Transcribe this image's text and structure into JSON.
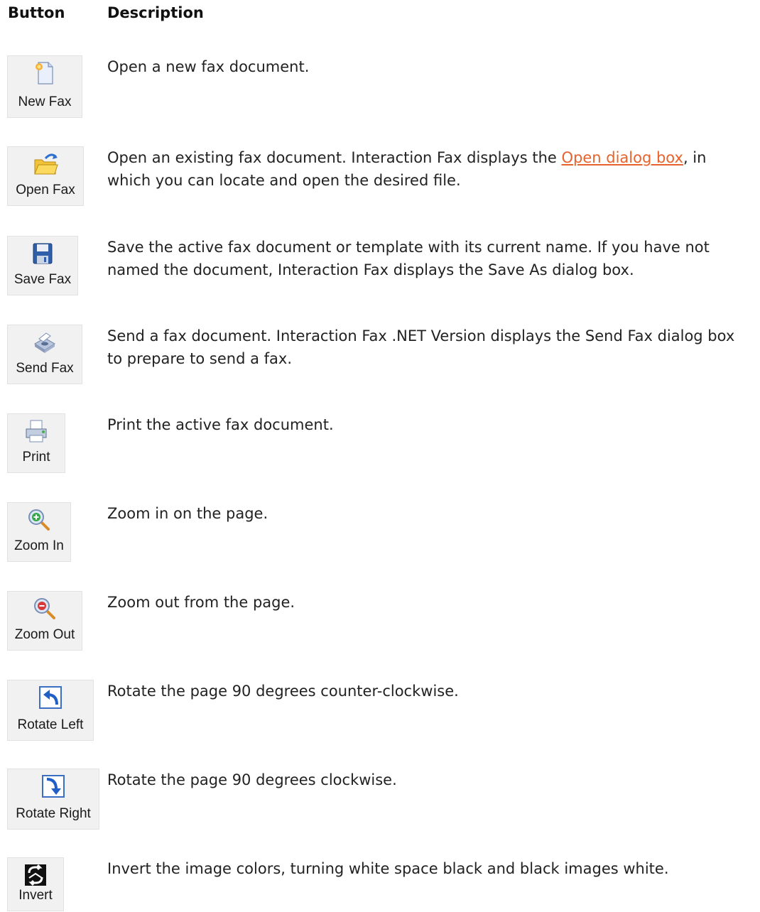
{
  "header": {
    "button": "Button",
    "description": "Description"
  },
  "rows": [
    {
      "label": "New Fax",
      "icon": "new-document-icon",
      "desc": "Open a new fax document."
    },
    {
      "label": "Open Fax",
      "icon": "open-folder-icon",
      "desc_pre": "Open an existing fax document. Interaction Fax displays the ",
      "link": "Open dialog box",
      "desc_post": ", in which you can locate and open the desired file."
    },
    {
      "label": "Save Fax",
      "icon": "floppy-disk-icon",
      "desc": "Save the active fax document or template with its current name. If you have not named the document, Interaction Fax displays the Save As dialog box."
    },
    {
      "label": "Send Fax",
      "icon": "fax-machine-icon",
      "desc": "Send a fax document. Interaction Fax .NET Version displays the Send Fax dialog box to prepare to send a fax."
    },
    {
      "label": "Print",
      "icon": "printer-icon",
      "desc": "Print the active fax document."
    },
    {
      "label": "Zoom In",
      "icon": "zoom-in-icon",
      "desc": "Zoom in on the page."
    },
    {
      "label": "Zoom Out",
      "icon": "zoom-out-icon",
      "desc": "Zoom out from the page."
    },
    {
      "label": "Rotate Left",
      "icon": "rotate-left-icon",
      "desc": "Rotate the page 90 degrees counter-clockwise."
    },
    {
      "label": "Rotate Right",
      "icon": "rotate-right-icon",
      "desc": "Rotate the page 90 degrees clockwise."
    },
    {
      "label": "Invert",
      "icon": "invert-icon",
      "desc": "Invert the image colors, turning white space black and black images white."
    }
  ]
}
